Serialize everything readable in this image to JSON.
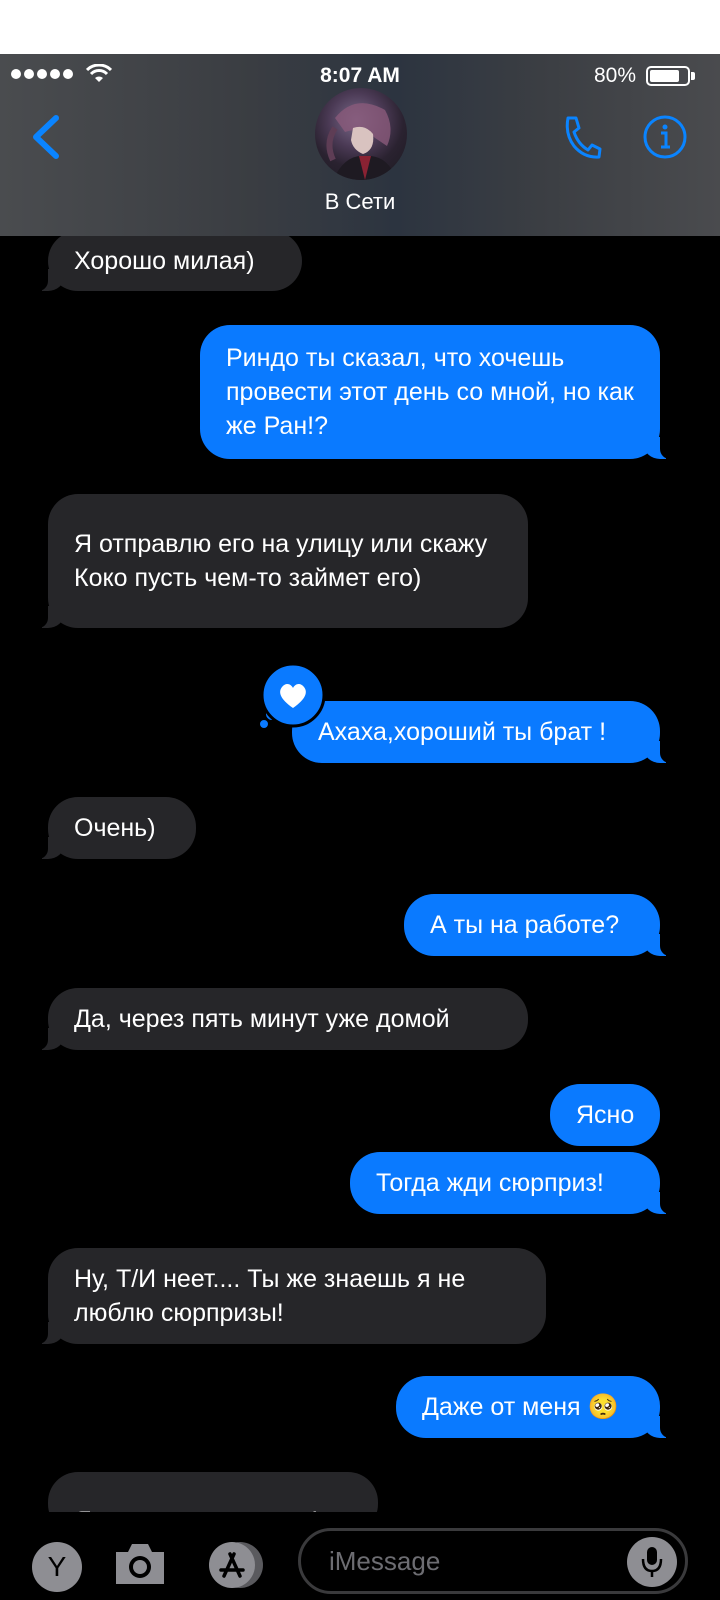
{
  "status_bar": {
    "time": "8:07 AM",
    "battery_percent": "80%"
  },
  "header": {
    "presence": "В Сети"
  },
  "messages": [
    {
      "side": "in",
      "text": "Хорошо милая)"
    },
    {
      "side": "out",
      "text": "Риндо ты сказал, что хочешь провести этот день со мной, но как же Ран!?"
    },
    {
      "side": "in",
      "text": "Я отправлю его на улицу или скажу Коко пусть чем-то займет его)"
    },
    {
      "side": "out",
      "text": "Ахаха,хороший ты брат !",
      "tapback": "heart"
    },
    {
      "side": "in",
      "text": "Очень)"
    },
    {
      "side": "out",
      "text": "А ты на работе?"
    },
    {
      "side": "in",
      "text": "Да, через пять минут уже домой"
    },
    {
      "side": "out",
      "text": "Ясно"
    },
    {
      "side": "out",
      "text": "Тогда жди сюрприз!"
    },
    {
      "side": "in",
      "text": "Ну, Т/И неет.... Ты же знаешь я не люблю сюрпризы!"
    },
    {
      "side": "out",
      "text": "Даже от меня 🥺"
    },
    {
      "side": "in",
      "text": "Я не это имел ввиду!"
    }
  ],
  "input_bar": {
    "app_label": "Y",
    "placeholder": "iMessage"
  },
  "colors": {
    "outgoing": "#0a7aff",
    "incoming": "#262629",
    "accent": "#0a84ff"
  }
}
